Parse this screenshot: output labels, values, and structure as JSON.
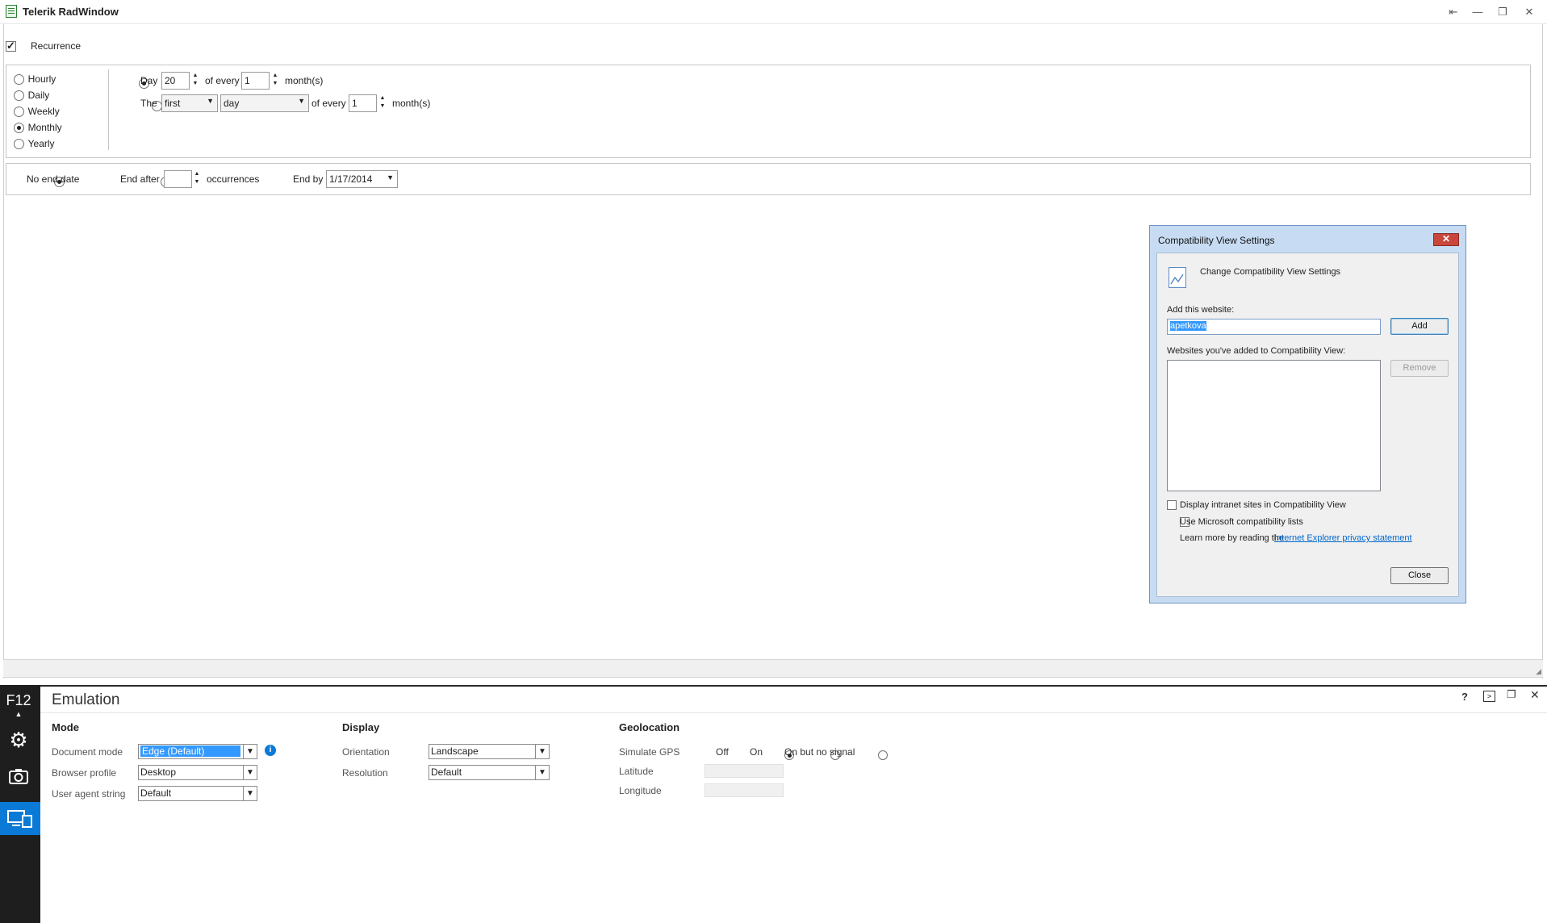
{
  "window": {
    "title": "Telerik RadWindow",
    "controls": [
      "pin-icon",
      "minimize-icon",
      "restore-icon",
      "close-icon"
    ]
  },
  "recurrence": {
    "checkbox_label": "Recurrence",
    "checked": true,
    "frequency_options": [
      "Hourly",
      "Daily",
      "Weekly",
      "Monthly",
      "Yearly"
    ],
    "selected_frequency": "Monthly",
    "monthly": {
      "day_label": "Day",
      "day_value": "20",
      "of_every_label": "of every",
      "interval_value": "1",
      "months_label": "month(s)",
      "the_label": "The",
      "ordinal_value": "first",
      "weekday_value": "day",
      "of_every_label_2": "of every",
      "interval_value_2": "1",
      "months_label_2": "month(s)"
    },
    "range": {
      "no_end_label": "No end date",
      "end_after_label": "End after",
      "occurrences_value": "",
      "occurrences_label": "occurrences",
      "end_by_label": "End by",
      "end_by_value": "1/17/2014"
    }
  },
  "compat_dialog": {
    "title": "Compatibility View Settings",
    "close_glyph": "✕",
    "heading": "Change Compatibility View Settings",
    "add_label": "Add this website:",
    "website_value": "apetkova",
    "add_button": "Add",
    "list_label": "Websites you've added to Compatibility View:",
    "remove_button": "Remove",
    "intranet_label": "Display intranet sites in Compatibility View",
    "ms_lists_label": "Use Microsoft compatibility lists",
    "learn_more_text": "Learn more by reading the",
    "privacy_link": "Internet Explorer privacy statement",
    "close_button": "Close"
  },
  "devtools": {
    "f12_label": "F12",
    "panel_title": "Emulation",
    "help_glyph": "?",
    "mode": {
      "title": "Mode",
      "document_mode_label": "Document mode",
      "document_mode_value": "Edge (Default)",
      "browser_profile_label": "Browser profile",
      "browser_profile_value": "Desktop",
      "user_agent_label": "User agent string",
      "user_agent_value": "Default"
    },
    "display": {
      "title": "Display",
      "orientation_label": "Orientation",
      "orientation_value": "Landscape",
      "resolution_label": "Resolution",
      "resolution_value": "Default"
    },
    "geolocation": {
      "title": "Geolocation",
      "simulate_gps_label": "Simulate GPS",
      "options": [
        "Off",
        "On",
        "On but no signal"
      ],
      "selected": "Off",
      "latitude_label": "Latitude",
      "longitude_label": "Longitude"
    }
  }
}
